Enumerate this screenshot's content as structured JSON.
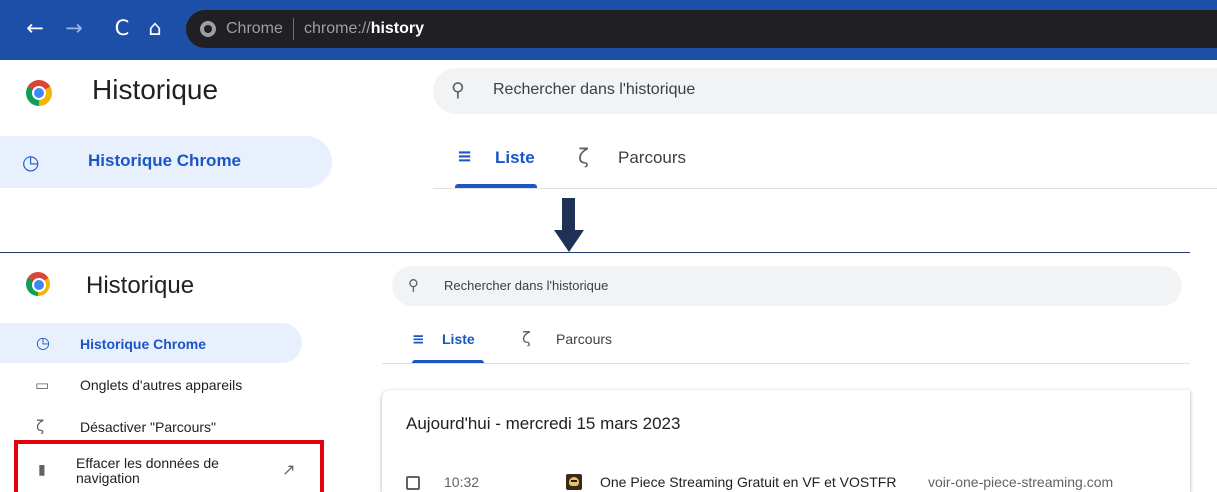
{
  "browser": {
    "back_icon": "arrow-left-icon",
    "forward_icon": "arrow-right-icon",
    "reload_icon": "reload-icon",
    "home_icon": "home-icon",
    "site_name": "Chrome",
    "url_prefix": "chrome://",
    "url_path": "history"
  },
  "header": {
    "title": "Historique",
    "search_placeholder": "Rechercher dans l'historique"
  },
  "sidebar": {
    "items": [
      {
        "label": "Historique Chrome",
        "icon": "clock-icon",
        "active": true
      },
      {
        "label": "Onglets d'autres appareils",
        "icon": "devices-icon",
        "active": false
      },
      {
        "label": "Désactiver \"Parcours\"",
        "icon": "route-off-icon",
        "active": false
      },
      {
        "label_line1": "Effacer les données de",
        "label_line2": "navigation",
        "icon": "trash-icon",
        "trailing_icon": "open-external-icon",
        "active": false
      }
    ]
  },
  "tabs": [
    {
      "label": "Liste",
      "icon": "list-icon",
      "active": true
    },
    {
      "label": "Parcours",
      "icon": "journeys-icon",
      "active": false
    }
  ],
  "history": {
    "day_heading": "Aujourd'hui - mercredi 15 mars 2023",
    "entries": [
      {
        "time": "10:32",
        "title": "One Piece Streaming Gratuit en VF et VOSTFR",
        "domain": "voir-one-piece-streaming.com"
      }
    ]
  },
  "colors": {
    "toolbar_blue": "#1e4fa8",
    "omnibox_dark": "#1f1f24",
    "accent_blue": "#1a56c4",
    "active_bg": "#e8f0fe",
    "highlight_red": "#e3000f",
    "arrow": "#1f3155"
  }
}
